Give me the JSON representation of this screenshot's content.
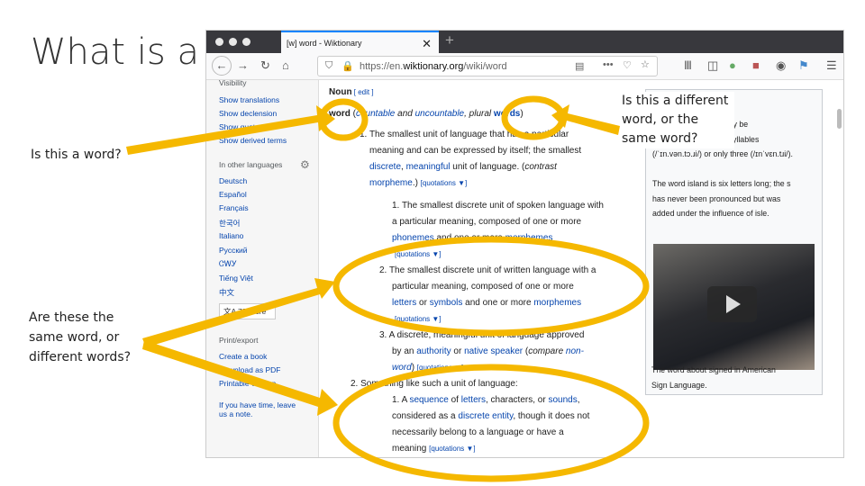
{
  "slide": {
    "title": "What is a word?",
    "question_word": "Is this a word?",
    "question_same": "Are these the same word, or different words?",
    "question_plural": "Is this a different word, or the same word?",
    "annotation_color": "#f5b800"
  },
  "browser": {
    "tab_title": "word - Wiktionary",
    "tab_icon": "[w]",
    "url_prefix": "https://en.",
    "url_domain": "wiktionary.org",
    "url_path": "/wiki/word"
  },
  "sidebar": {
    "visibility": "Visibility",
    "visibility_items": [
      "Show translations",
      "Show declension",
      "Show quotations",
      "Show derived terms"
    ],
    "languages_heading": "In other languages",
    "languages": [
      "Deutsch",
      "Español",
      "Français",
      "한국어",
      "Italiano",
      "Русский",
      "ᏣᎳᎩ",
      "Tiếng Việt",
      "中文"
    ],
    "lang_button": "文A 78 more",
    "print_heading": "Print/export",
    "print_items": [
      "Create a book",
      "Download as PDF",
      "Printable version"
    ],
    "note": [
      "If you have time, leave",
      "us a note."
    ]
  },
  "main": {
    "lines": [
      [
        [
          "bold",
          "Noun"
        ],
        [
          "small",
          "   [ edit ]"
        ]
      ],
      [
        [
          "bold",
          "word"
        ],
        [
          "plain",
          " ("
        ],
        [
          "it link",
          "countable"
        ],
        [
          "it",
          " and "
        ],
        [
          "it link",
          "uncountable"
        ],
        [
          "it",
          ", plural "
        ],
        [
          "bold link",
          "words"
        ],
        [
          "plain",
          ")"
        ]
      ],
      [
        [
          "plain",
          "1. The smallest unit of language that has a particular"
        ]
      ],
      [
        [
          "plain",
          "meaning and can be expressed by itself; the smallest"
        ]
      ],
      [
        [
          "link",
          "discrete"
        ],
        [
          "plain",
          ", "
        ],
        [
          "link",
          "meaningful"
        ],
        [
          "plain",
          " unit of language. ("
        ],
        [
          "it",
          "contrast"
        ]
      ],
      [
        [
          "link",
          "morpheme"
        ],
        [
          "plain",
          ".)  "
        ],
        [
          "small",
          "[quotations ▼]"
        ]
      ],
      [
        [
          "plain",
          "1. The smallest discrete unit of spoken language with"
        ]
      ],
      [
        [
          "plain",
          "a particular meaning, composed of one or more"
        ]
      ],
      [
        [
          "link",
          "phonemes"
        ],
        [
          "plain",
          " and one or more "
        ],
        [
          "link",
          "morphemes"
        ]
      ],
      [
        [
          "small",
          "[quotations ▼]"
        ]
      ],
      [
        [
          "plain",
          "2. The smallest discrete unit of written language with a"
        ]
      ],
      [
        [
          "plain",
          "particular meaning, composed of one or more"
        ]
      ],
      [
        [
          "link",
          "letters"
        ],
        [
          "plain",
          " or "
        ],
        [
          "link",
          "symbols"
        ],
        [
          "plain",
          " and one or more "
        ],
        [
          "link",
          "morphemes"
        ]
      ],
      [
        [
          "small",
          "[quotations ▼]"
        ]
      ],
      [
        [
          "plain",
          "3. A discrete, meaningful unit of language approved"
        ]
      ],
      [
        [
          "plain",
          "by an "
        ],
        [
          "link",
          "authority"
        ],
        [
          "plain",
          " or "
        ],
        [
          "link",
          "native speaker"
        ],
        [
          "plain",
          " ("
        ],
        [
          "it",
          "compare "
        ],
        [
          "it link",
          "non-"
        ]
      ],
      [
        [
          "it link",
          "word"
        ],
        [
          "plain",
          ")  "
        ],
        [
          "small",
          "[quotations ▼]"
        ]
      ],
      [
        [
          "plain",
          "2. Something like such a unit of language:"
        ]
      ],
      [
        [
          "plain",
          "1. A "
        ],
        [
          "link",
          "sequence"
        ],
        [
          "plain",
          " of "
        ],
        [
          "link",
          "letters"
        ],
        [
          "plain",
          ", characters, or "
        ],
        [
          "link",
          "sounds"
        ],
        [
          "plain",
          ","
        ]
      ],
      [
        [
          "plain",
          "considered as a "
        ],
        [
          "link",
          "discrete entity"
        ],
        [
          "plain",
          ", though it does not"
        ]
      ],
      [
        [
          "plain",
          "necessarily belong to a language or have a"
        ]
      ],
      [
        [
          "plain",
          "meaning  "
        ],
        [
          "small",
          "[quotations ▼]"
        ]
      ]
    ]
  },
  "infobox": {
    "lines": [
      "The word inventory may be",
      "pronounced with four syllables",
      "(/ˈɪn.vən.tɔ.ɹi/) or only three (/ɪnˈvɛn.tɹi/).",
      "",
      "The word island is six letters long; the s",
      "has never been pronounced but was",
      "added under the influence of isle."
    ],
    "caption": [
      "The word about signed in American",
      "Sign Language."
    ]
  }
}
